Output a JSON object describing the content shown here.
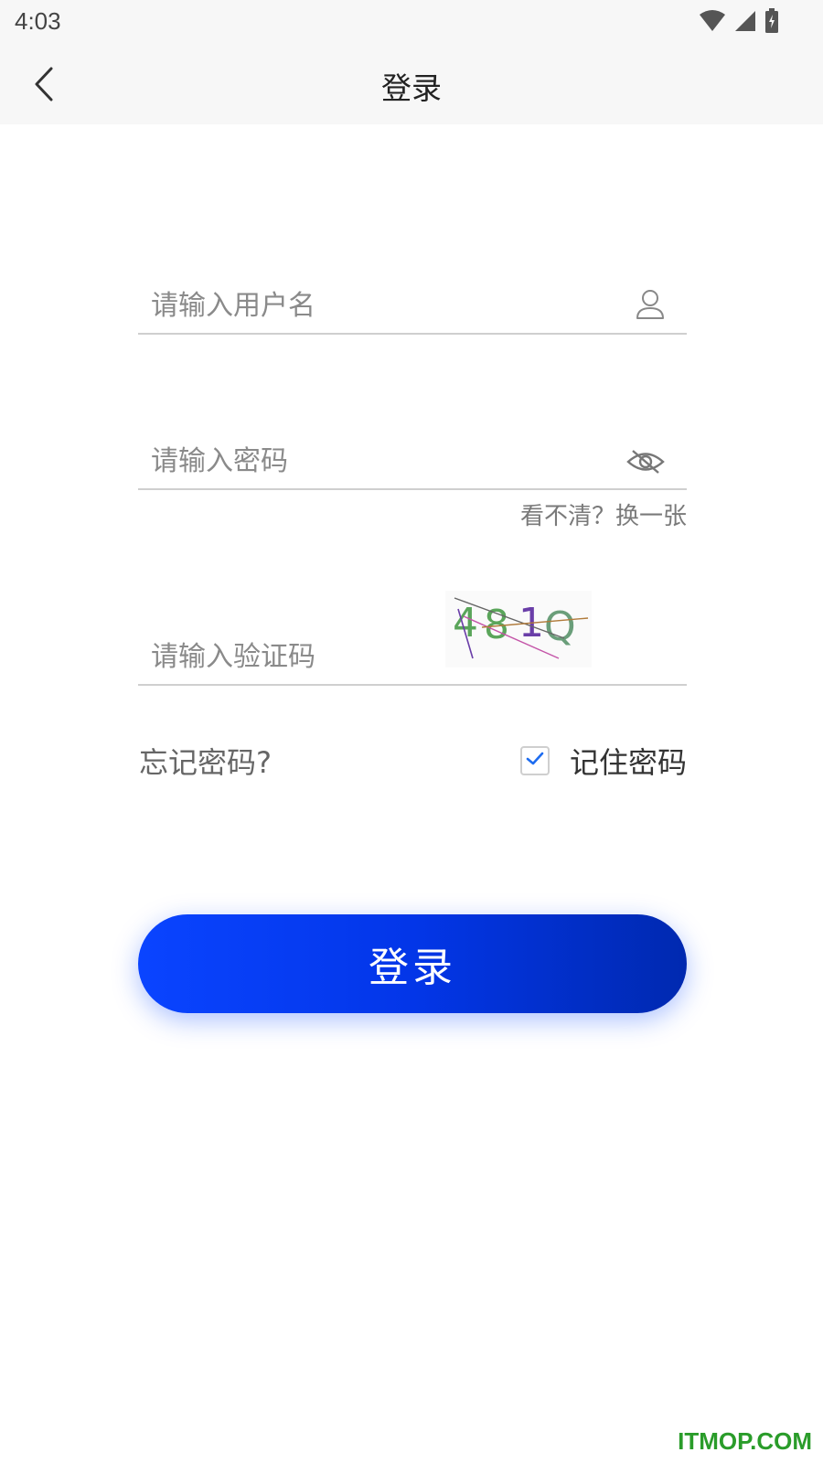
{
  "status_bar": {
    "time": "4:03",
    "icons": [
      "wifi-icon",
      "signal-icon",
      "battery-charging-icon"
    ]
  },
  "nav": {
    "title": "登录",
    "back_icon": "chevron-left-icon"
  },
  "form": {
    "username": {
      "placeholder": "请输入用户名",
      "value": "",
      "icon": "user-icon"
    },
    "password": {
      "placeholder": "请输入密码",
      "value": "",
      "icon": "eye-off-icon"
    },
    "refresh_captcha_label": "看不清？换一张",
    "captcha": {
      "placeholder": "请输入验证码",
      "value": "",
      "image_text": "481Q",
      "image_colors": [
        "#5aa55a",
        "#5aa55a",
        "#6a3ea8",
        "#6a9e7a"
      ]
    },
    "forgot_password_label": "忘记密码?",
    "remember_password": {
      "label": "记住密码",
      "checked": true
    },
    "login_button_label": "登录"
  },
  "colors": {
    "primary": "#0a44ff",
    "primary_dark": "#0029b0",
    "checkbox_tick": "#1d6cf0"
  },
  "watermark": "ITMOP.COM"
}
